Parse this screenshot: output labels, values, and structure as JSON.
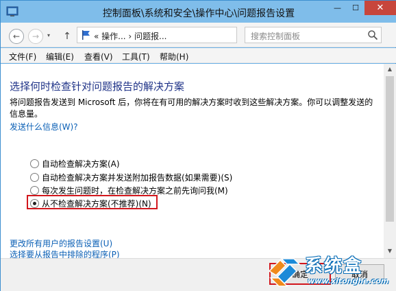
{
  "window": {
    "title": "控制面板\\系统和安全\\操作中心\\问题报告设置",
    "minimize": "—",
    "maximize": "☐",
    "close": "✕"
  },
  "nav": {
    "back_icon": "←",
    "forward_icon": "→",
    "dropdown_icon": "▾",
    "up_icon": "↑",
    "address_text": "« 操作... › 问题报...",
    "address_dropdown": "▾",
    "refresh_icon": "↻",
    "search_placeholder": "搜索控制面板"
  },
  "menu": {
    "file": "文件(F)",
    "edit": "编辑(E)",
    "view": "查看(V)",
    "tools": "工具(T)",
    "help": "帮助(H)"
  },
  "main": {
    "heading": "选择何时检查针对问题报告的解决方案",
    "description": "将问题报告发送到 Microsoft 后，你将在有可用的解决方案时收到这些解决方案。你可以调整发送的信息量。",
    "info_link": "发送什么信息(W)?",
    "options": [
      {
        "label": "自动检查解决方案(A)",
        "checked": false
      },
      {
        "label": "自动检查解决方案并发送附加报告数据(如果需要)(S)",
        "checked": false
      },
      {
        "label": "每次发生问题时，在检查解决方案之前先询问我(M)",
        "checked": false
      },
      {
        "label": "从不检查解决方案(不推荐)(N)",
        "checked": true
      }
    ],
    "all_users_link": "更改所有用户的报告设置(U)",
    "exclude_link": "选择要从报告中排除的程序(P)"
  },
  "footer": {
    "ok_label": "确定",
    "cancel_label": "取消"
  },
  "watermark": {
    "brand": "系统盒",
    "url": "www.xitonghe.com"
  },
  "colors": {
    "accent_red": "#d2161c",
    "link_blue": "#0a5fb5",
    "heading_blue": "#1e3287",
    "titlebar": "#7fbdea"
  }
}
